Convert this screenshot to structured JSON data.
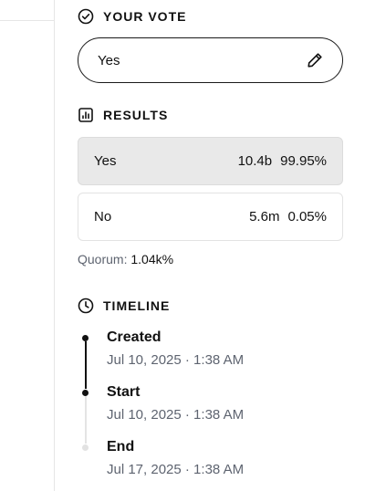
{
  "your_vote": {
    "heading": "YOUR VOTE",
    "selected": "Yes"
  },
  "results": {
    "heading": "RESULTS",
    "rows": [
      {
        "label": "Yes",
        "amount": "10.4b",
        "percent": "99.95%"
      },
      {
        "label": "No",
        "amount": "5.6m",
        "percent": "0.05%"
      }
    ],
    "quorum_label": "Quorum:",
    "quorum_value": "1.04k%"
  },
  "timeline": {
    "heading": "TIMELINE",
    "events": [
      {
        "title": "Created",
        "date": "Jul 10, 2025 · 1:38 AM",
        "state": "done"
      },
      {
        "title": "Start",
        "date": "Jul 10, 2025 · 1:38 AM",
        "state": "done"
      },
      {
        "title": "End",
        "date": "Jul 17, 2025 · 1:38 AM",
        "state": "upcoming"
      }
    ]
  },
  "colors": {
    "text": "#111111",
    "muted": "#5e6470",
    "selected_row_bg": "#e9e9e9",
    "upcoming_dot": "#e2e2e2"
  }
}
